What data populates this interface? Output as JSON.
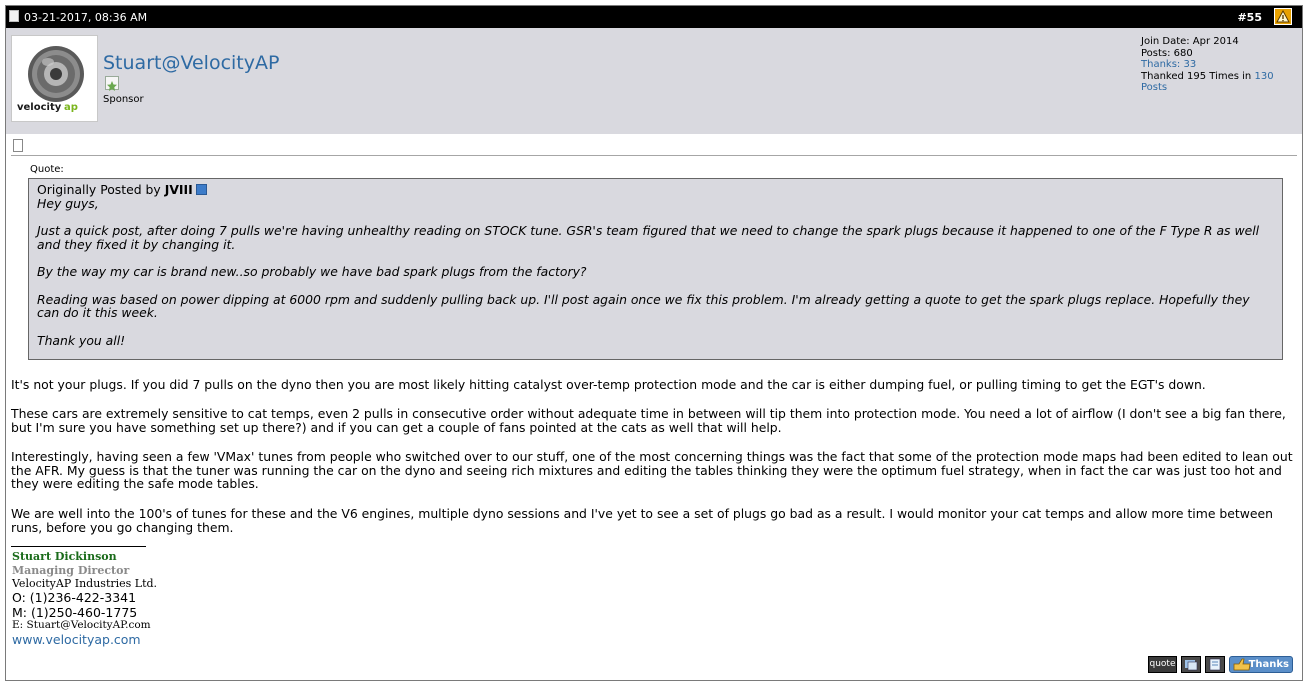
{
  "post": {
    "date": "03-21-2017, 08:36 AM",
    "number": "#55"
  },
  "user": {
    "name": "Stuart@VelocityAP",
    "title": "Sponsor",
    "avatar_text": "velocityap",
    "join_date": "Join Date: Apr 2014",
    "posts": "Posts: 680",
    "thanks": "Thanks: 33",
    "thanked_prefix": "Thanked 195 Times in",
    "thanked_posts": "130 Posts"
  },
  "quote": {
    "label": "Quote:",
    "originally_posted_by": "Originally Posted by",
    "author": "JVIII",
    "paragraphs": [
      "Hey guys,",
      "Just a quick post, after doing 7 pulls we're having unhealthy reading on STOCK tune. GSR's team figured that we need to change the spark plugs because it happened to one of the F Type R as well and they fixed it by changing it.",
      "By the way my car is brand new..so probably we have bad spark plugs from the factory?",
      "Reading was based on power dipping at 6000 rpm and suddenly pulling back up. I'll post again once we fix this problem. I'm already getting a quote to get the spark plugs replace. Hopefully they can do it this week.",
      "Thank you all!"
    ]
  },
  "message": [
    "It's not your plugs. If you did 7 pulls on the dyno then you are most likely hitting catalyst over-temp protection mode and the car is either dumping fuel, or pulling timing to get the EGT's down.",
    "These cars are extremely sensitive to cat temps, even 2 pulls in consecutive order without adequate time in between will tip them into protection mode. You need a lot of airflow (I don't see a big fan there, but I'm sure you have something set up there?) and if you can get a couple of fans pointed at the cats as well that will help.",
    "Interestingly, having seen a few 'VMax' tunes from people who switched over to our stuff, one of the most concerning things was the fact that some of the protection mode maps had been edited to lean out the AFR. My guess is that the tuner was running the car on the dyno and seeing rich mixtures and editing the tables thinking they were the optimum fuel strategy, when in fact the car was just too hot and they were editing the safe mode tables.",
    "We are well into the 100's of tunes for these and the V6 engines, multiple dyno sessions and I've yet to see a set of plugs go bad as a result. I would monitor your cat temps and allow more time between runs, before you go changing them."
  ],
  "signature": {
    "name": "Stuart Dickinson",
    "role": "Managing Director",
    "company": "VelocityAP Industries Ltd.",
    "office": "O: (1)236-422-3341",
    "mobile": "M: (1)250-460-1775",
    "email": "E: Stuart@VelocityAP.com",
    "website": "www.velocityap.com"
  },
  "buttons": {
    "quote": "quote",
    "thanks": "Thanks"
  },
  "colors": {
    "header_bg": "#000000",
    "userbar_bg": "#d9d9df",
    "link": "#2e6aa3",
    "sig_name": "#1a6b1a",
    "sig_role": "#8a8a8a"
  },
  "icons": [
    "document-icon",
    "report-icon",
    "rank-icon",
    "post-icon",
    "view-post-icon",
    "multiquote-icon",
    "edit-icon",
    "thanks-icon"
  ]
}
